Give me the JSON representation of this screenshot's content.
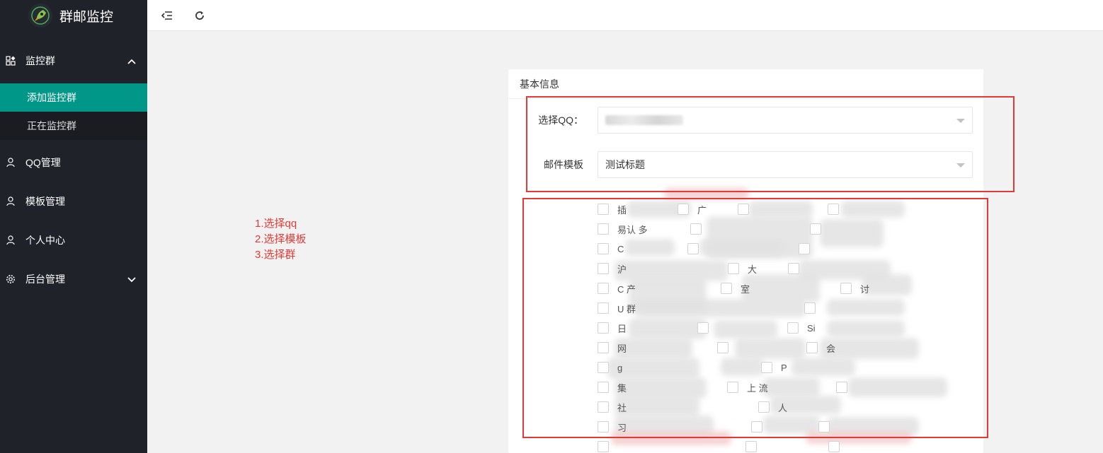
{
  "app": {
    "title": "群邮监控",
    "colors": {
      "sidebar": "#20222a",
      "sidebar_sub": "#1a1c22",
      "accent": "#009688",
      "annotation": "#e53935"
    }
  },
  "sidebar": {
    "menu": [
      {
        "label": "监控群",
        "icon": "dashboard-icon",
        "expanded": true,
        "children": [
          {
            "label": "添加监控群",
            "active": true
          },
          {
            "label": "正在监控群",
            "active": false
          }
        ]
      },
      {
        "label": "QQ管理",
        "icon": "user-icon"
      },
      {
        "label": "模板管理",
        "icon": "user-icon"
      },
      {
        "label": "个人中心",
        "icon": "user-icon"
      },
      {
        "label": "后台管理",
        "icon": "gear-icon",
        "expanded": false
      }
    ]
  },
  "topbar": {
    "buttons": [
      "menu-collapse-icon",
      "refresh-icon"
    ]
  },
  "card": {
    "title": "基本信息",
    "qq_select": {
      "label": "选择QQ：",
      "value": ""
    },
    "template_select": {
      "label": "邮件模板",
      "value": "测试标题"
    },
    "groups": [
      [
        "插",
        "广",
        "",
        ""
      ],
      [
        "易认 多",
        "",
        ""
      ],
      [
        "C",
        "",
        ""
      ],
      [
        "沪",
        "大",
        ""
      ],
      [
        "C 产",
        "室",
        "讨"
      ],
      [
        "U 群",
        ""
      ],
      [
        "日",
        "",
        "Si"
      ],
      [
        "网",
        "",
        "会"
      ],
      [
        "g",
        "P"
      ],
      [
        "集",
        "上 流",
        ""
      ],
      [
        "社",
        "人"
      ],
      [
        "习",
        "",
        ""
      ],
      [
        "",
        "",
        ""
      ]
    ]
  },
  "notes": [
    "1.选择qq",
    "2.选择模板",
    "3.选择群"
  ]
}
